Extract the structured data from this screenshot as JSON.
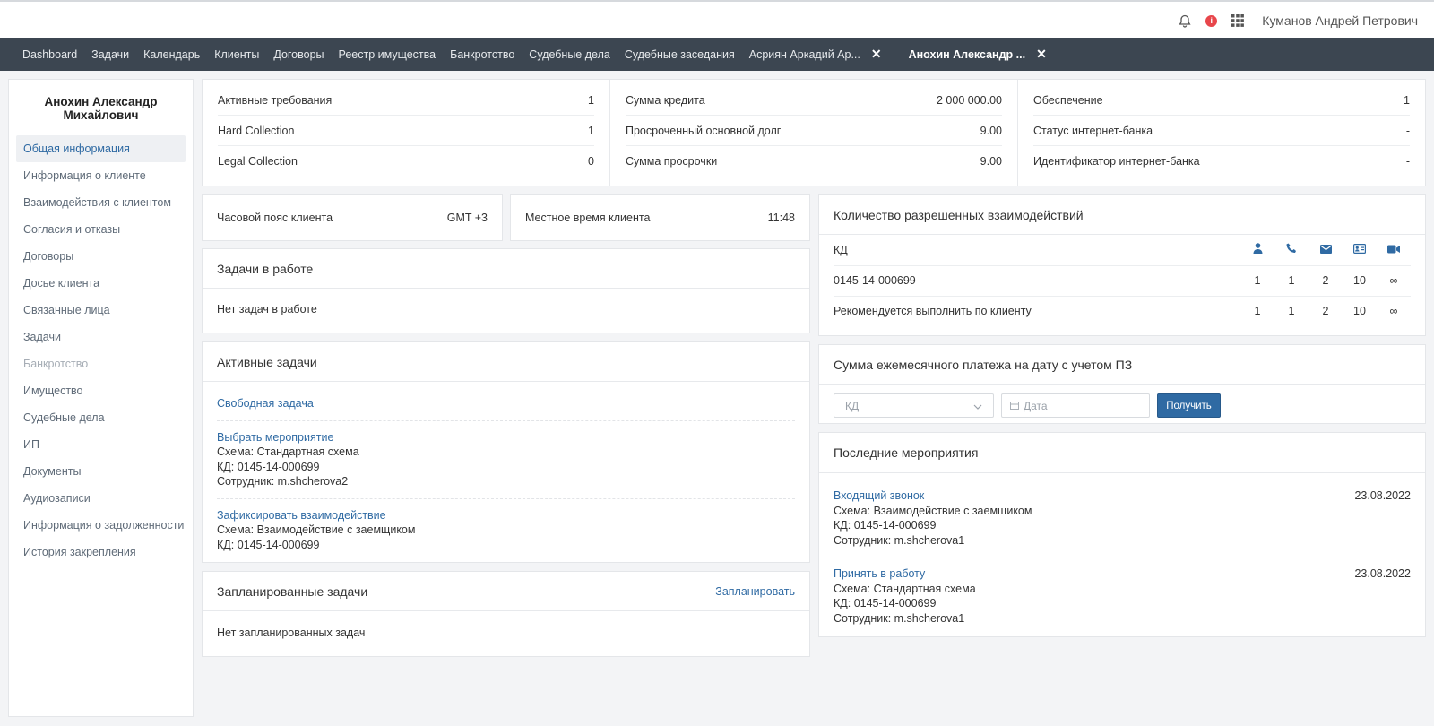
{
  "header": {
    "user_name": "Куманов Андрей Петрович",
    "alert_glyph": "i"
  },
  "nav": {
    "items": [
      "Dashboard",
      "Задачи",
      "Календарь",
      "Клиенты",
      "Договоры",
      "Реестр имущества",
      "Банкротство",
      "Судебные дела",
      "Судебные заседания",
      "Асриян Аркадий Ар..."
    ],
    "active_tab": "Анохин Александр ...",
    "close_glyph": "✕"
  },
  "sidebar": {
    "client_name": "Анохин Александр Михайлович",
    "items": [
      {
        "label": "Общая информация"
      },
      {
        "label": "Информация о клиенте"
      },
      {
        "label": "Взаимодействия с клиентом"
      },
      {
        "label": "Согласия и отказы"
      },
      {
        "label": "Договоры"
      },
      {
        "label": "Досье клиента"
      },
      {
        "label": "Связанные лица"
      },
      {
        "label": "Задачи"
      },
      {
        "label": "Банкротство"
      },
      {
        "label": "Имущество"
      },
      {
        "label": "Судебные дела"
      },
      {
        "label": "ИП"
      },
      {
        "label": "Документы"
      },
      {
        "label": "Аудиозаписи"
      },
      {
        "label": "Информация о задолженности"
      },
      {
        "label": "История закрепления"
      }
    ]
  },
  "stats": {
    "col1": [
      {
        "label": "Активные требования",
        "value": "1"
      },
      {
        "label": "Hard Collection",
        "value": "1"
      },
      {
        "label": "Legal Collection",
        "value": "0"
      }
    ],
    "col2": [
      {
        "label": "Сумма кредита",
        "value": "2 000 000.00"
      },
      {
        "label": "Просроченный основной долг",
        "value": "9.00"
      },
      {
        "label": "Сумма просрочки",
        "value": "9.00"
      }
    ],
    "col3": [
      {
        "label": "Обеспечение",
        "value": "1"
      },
      {
        "label": "Статус интернет-банка",
        "value": "-"
      },
      {
        "label": "Идентификатор интернет-банка",
        "value": "-"
      }
    ]
  },
  "timezone": {
    "label": "Часовой пояс клиента",
    "value": "GMT +3"
  },
  "localtime": {
    "label": "Местное время клиента",
    "value": "11:48"
  },
  "tasks_in_work": {
    "title": "Задачи в работе",
    "empty": "Нет задач в работе"
  },
  "active_tasks": {
    "title": "Активные задачи",
    "items": [
      {
        "name": "Свободная задача",
        "lines": []
      },
      {
        "name": "Выбрать мероприятие",
        "lines": [
          "Схема: Стандартная схема",
          "КД: 0145-14-000699",
          "Сотрудник: m.shcherova2"
        ]
      },
      {
        "name": "Зафиксировать взаимодействие",
        "lines": [
          "Схема: Взаимодействие с заемщиком",
          "КД: 0145-14-000699"
        ]
      }
    ]
  },
  "planned_tasks": {
    "title": "Запланированные задачи",
    "action": "Запланировать",
    "empty": "Нет запланированных задач"
  },
  "interactions": {
    "title": "Количество разрешенных взаимодействий",
    "header_label": "КД",
    "icons": [
      "person-icon",
      "phone-icon",
      "envelope-icon",
      "id-card-icon",
      "video-icon"
    ],
    "rows": [
      {
        "label": "0145-14-000699",
        "values": [
          "1",
          "1",
          "2",
          "10",
          "∞"
        ]
      },
      {
        "label": "Рекомендуется выполнить по клиенту",
        "values": [
          "1",
          "1",
          "2",
          "10",
          "∞"
        ]
      }
    ]
  },
  "monthly_payment": {
    "title": "Сумма ежемесячного платежа на дату с учетом ПЗ",
    "select_placeholder": "КД",
    "date_placeholder": "Дата",
    "button": "Получить"
  },
  "last_events": {
    "title": "Последние мероприятия",
    "items": [
      {
        "name": "Входящий звонок",
        "date": "23.08.2022",
        "lines": [
          "Схема: Взаимодействие с заемщиком",
          "КД: 0145-14-000699",
          "Сотрудник: m.shcherova1"
        ]
      },
      {
        "name": "Принять в работу",
        "date": "23.08.2022",
        "lines": [
          "Схема: Стандартная схема",
          "КД: 0145-14-000699",
          "Сотрудник: m.shcherova1"
        ]
      }
    ]
  },
  "colors": {
    "accent": "#2f6aa3",
    "nav_bg": "#3c4651",
    "alert": "#e8464b"
  }
}
